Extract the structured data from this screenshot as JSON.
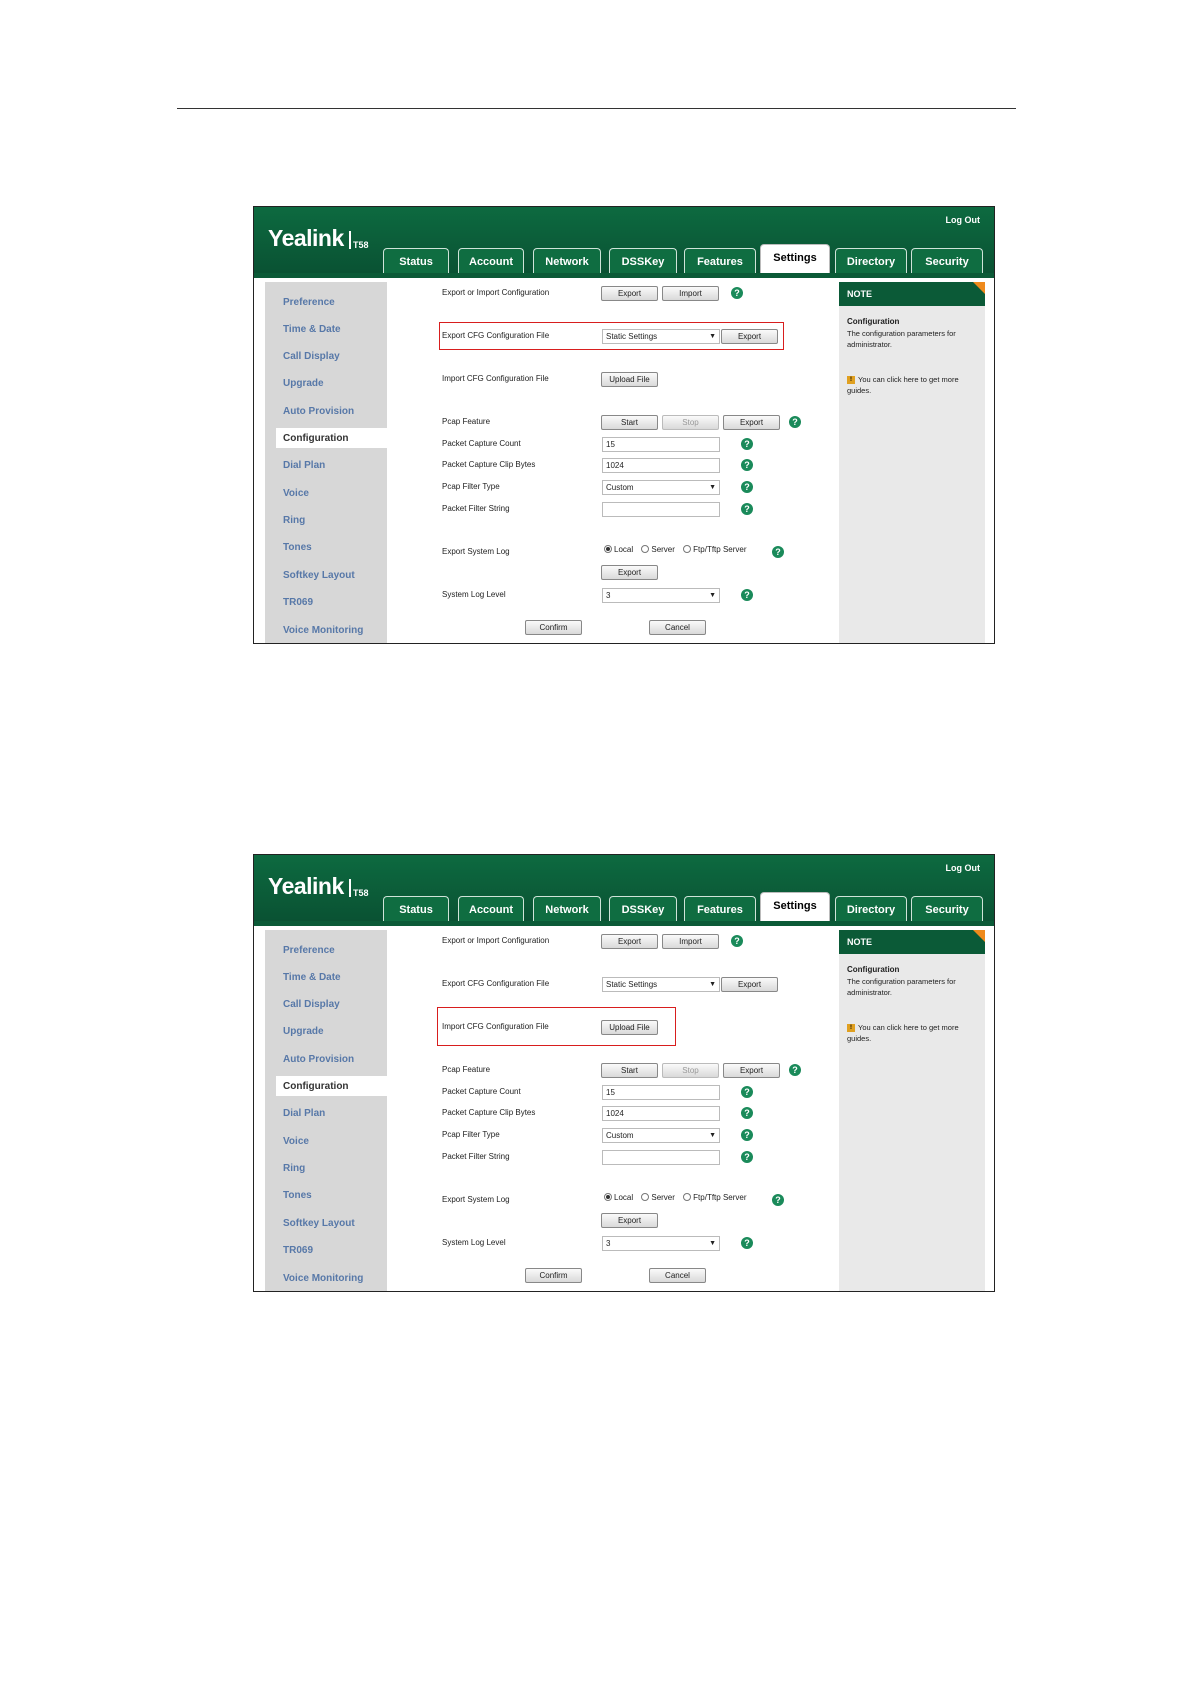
{
  "brand": {
    "logo": "Yealink",
    "model": "T58",
    "logout": "Log Out"
  },
  "tabs": [
    "Status",
    "Account",
    "Network",
    "DSSKey",
    "Features",
    "Settings",
    "Directory",
    "Security"
  ],
  "sidebar": [
    "Preference",
    "Time & Date",
    "Call Display",
    "Upgrade",
    "Auto Provision",
    "Configuration",
    "Dial Plan",
    "Voice",
    "Ring",
    "Tones",
    "Softkey Layout",
    "TR069",
    "Voice Monitoring"
  ],
  "form": {
    "export_import_label": "Export or Import Configuration",
    "export_btn": "Export",
    "import_btn": "Import",
    "export_cfg_label": "Export CFG Configuration File",
    "export_cfg_value": "Static Settings",
    "import_cfg_label": "Import CFG Configuration File",
    "upload_btn": "Upload File",
    "pcap_label": "Pcap Feature",
    "start_btn": "Start",
    "stop_btn": "Stop",
    "capture_count_label": "Packet Capture Count",
    "capture_count_value": "15",
    "clip_bytes_label": "Packet Capture Clip Bytes",
    "clip_bytes_value": "1024",
    "filter_type_label": "Pcap Filter Type",
    "filter_type_value": "Custom",
    "filter_string_label": "Packet Filter String",
    "filter_string_value": "",
    "syslog_label": "Export System Log",
    "radio_local": "Local",
    "radio_server": "Server",
    "radio_ftp": "Ftp/Tftp Server",
    "log_level_label": "System Log Level",
    "log_level_value": "3",
    "confirm_btn": "Confirm",
    "cancel_btn": "Cancel"
  },
  "note": {
    "header": "NOTE",
    "title": "Configuration",
    "text": "The configuration parameters for administrator.",
    "guide": "You can click here to get more guides."
  },
  "help_glyph": "?",
  "colors": {
    "header_green": "#0b5a37",
    "highlight_red": "#d81e1e",
    "note_corner": "#ef8a1c",
    "sidebar_link": "#5778a8"
  }
}
